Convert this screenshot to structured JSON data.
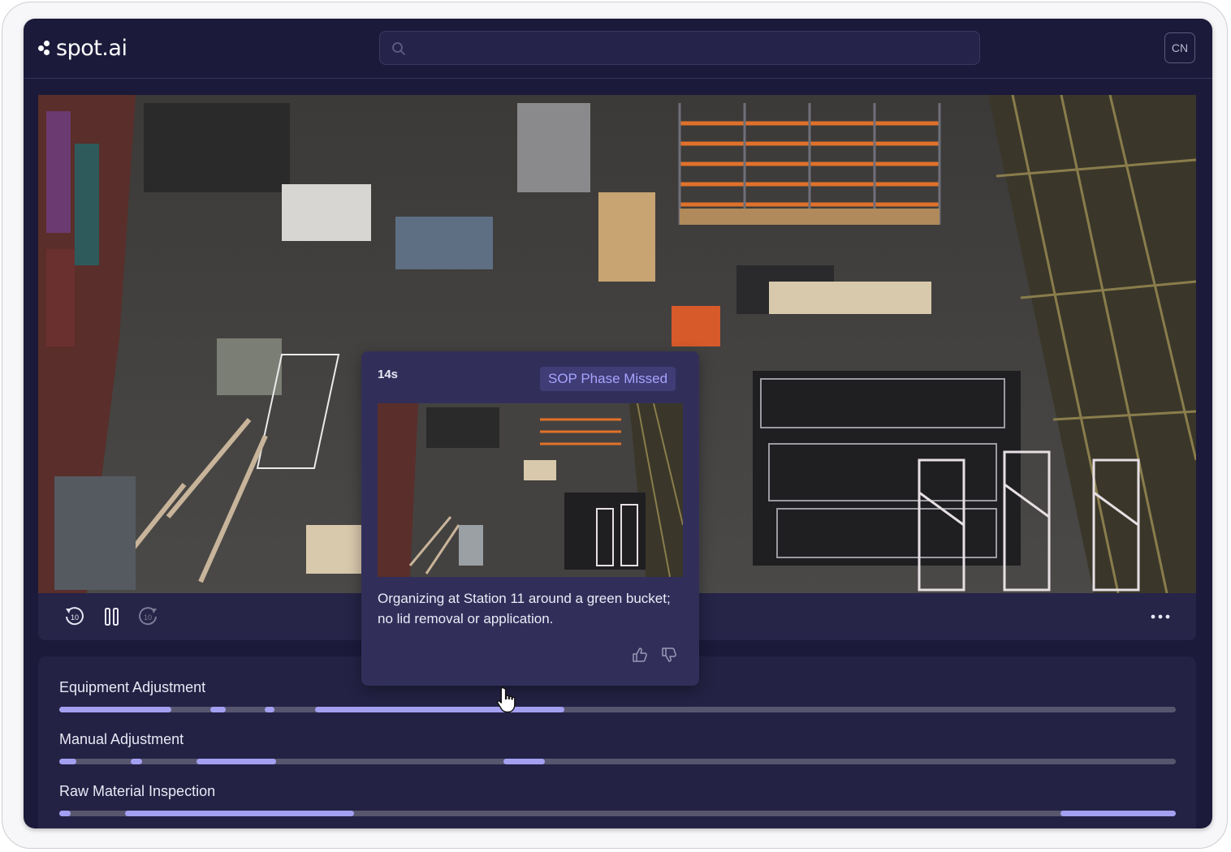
{
  "app": {
    "logo_text": "spot.ai",
    "user_initials": "CN"
  },
  "search": {
    "placeholder": "",
    "value": ""
  },
  "player": {
    "controls": {
      "rewind_label": "10",
      "forward_label": "10"
    }
  },
  "event_popup": {
    "time": "14s",
    "badge": "SOP Phase Missed",
    "description": "Organizing at Station 11 around a green bucket; no lid removal or application."
  },
  "tracks": [
    {
      "label": "Equipment Adjustment",
      "segments": [
        [
          0.0,
          0.1
        ],
        [
          0.135,
          0.149
        ],
        [
          0.184,
          0.193
        ],
        [
          0.229,
          0.452
        ]
      ]
    },
    {
      "label": "Manual Adjustment",
      "segments": [
        [
          0.0,
          0.015
        ],
        [
          0.064,
          0.074
        ],
        [
          0.123,
          0.194
        ],
        [
          0.398,
          0.435
        ]
      ]
    },
    {
      "label": "Raw Material Inspection",
      "segments": [
        [
          0.0,
          0.01
        ],
        [
          0.059,
          0.264
        ],
        [
          0.897,
          1.0
        ]
      ]
    }
  ],
  "colors": {
    "accent": "#a3a0f2",
    "background": "#1c1a3a",
    "badge_text": "#a7a4ff"
  }
}
